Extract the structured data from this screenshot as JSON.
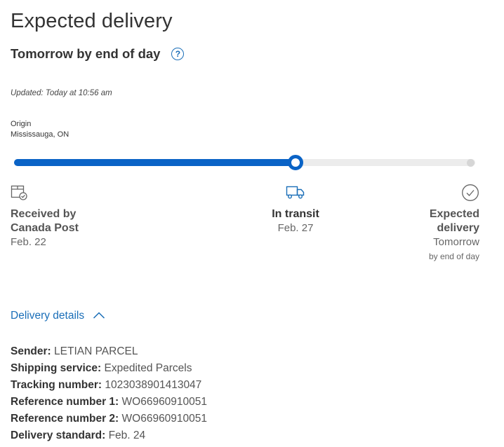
{
  "header": {
    "title": "Expected delivery",
    "subtitle": "Tomorrow by end of day",
    "help_icon_glyph": "?",
    "updated": "Updated: Today at 10:56 am"
  },
  "origin": {
    "label": "Origin",
    "value": "Mississauga, ON"
  },
  "progress": {
    "fraction": 0.61,
    "accent": "#0a63c6",
    "track_color": "#ececec"
  },
  "steps": [
    {
      "icon": "package-received-icon",
      "name_line1": "Received by",
      "name_line2": "Canada Post",
      "date": "Feb. 22"
    },
    {
      "icon": "truck-icon",
      "name": "In transit",
      "date": "Feb. 27"
    },
    {
      "icon": "check-circle-icon",
      "name_line1": "Expected",
      "name_line2": "delivery",
      "date": "Tomorrow",
      "sub": "by end of day"
    }
  ],
  "details_toggle": {
    "label": "Delivery details",
    "icon": "chevron-up-icon",
    "link_color": "#1a6eb8"
  },
  "details": [
    {
      "label": "Sender:",
      "value": "LETIAN PARCEL"
    },
    {
      "label": "Shipping service:",
      "value": "Expedited Parcels"
    },
    {
      "label": "Tracking number:",
      "value": "1023038901413047"
    },
    {
      "label": "Reference number 1:",
      "value": "WO66960910051"
    },
    {
      "label": "Reference number 2:",
      "value": "WO66960910051"
    },
    {
      "label": "Delivery standard:",
      "value": "Feb. 24"
    }
  ]
}
